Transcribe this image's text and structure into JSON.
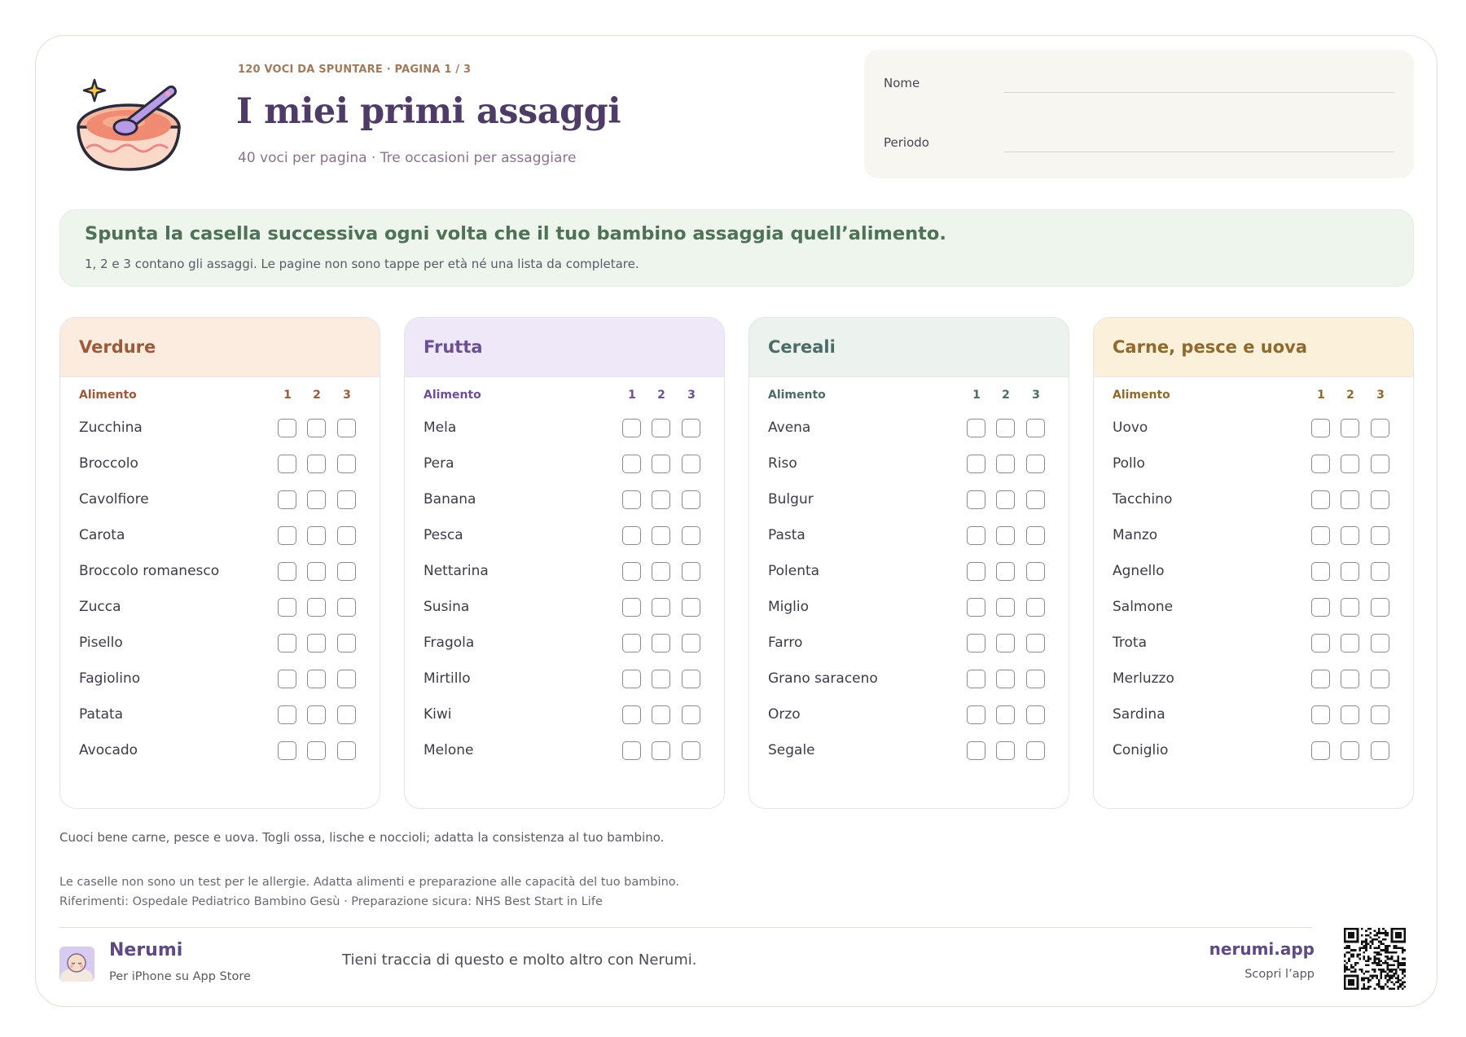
{
  "header": {
    "kicker": "120 VOCI DA SPUNTARE · PAGINA 1 / 3",
    "title": "I miei primi assaggi",
    "subtitle": "40 voci per pagina · Tre occasioni per assaggiare"
  },
  "form": {
    "name_label": "Nome",
    "period_label": "Periodo"
  },
  "banner": {
    "title": "Spunta la casella successiva ogni volta che il tuo bambino assaggia quell’alimento.",
    "subtitle": "1, 2 e 3 contano gli assaggi. Le pagine non sono tappe per età né una lista da completare."
  },
  "table_headers": {
    "food": "Alimento",
    "n1": "1",
    "n2": "2",
    "n3": "3"
  },
  "categories": [
    {
      "title": "Verdure",
      "color": "#9b5a39",
      "items": [
        "Zucchina",
        "Broccolo",
        "Cavolfiore",
        "Carota",
        "Broccolo romanesco",
        "Zucca",
        "Pisello",
        "Fagiolino",
        "Patata",
        "Avocado"
      ]
    },
    {
      "title": "Frutta",
      "color": "#6c4f94",
      "items": [
        "Mela",
        "Pera",
        "Banana",
        "Pesca",
        "Nettarina",
        "Susina",
        "Fragola",
        "Mirtillo",
        "Kiwi",
        "Melone"
      ]
    },
    {
      "title": "Cereali",
      "color": "#4d6b67",
      "items": [
        "Avena",
        "Riso",
        "Bulgur",
        "Pasta",
        "Polenta",
        "Miglio",
        "Farro",
        "Grano saraceno",
        "Orzo",
        "Segale"
      ]
    },
    {
      "title": "Carne, pesce e uova",
      "color": "#8f6a2c",
      "items": [
        "Uovo",
        "Pollo",
        "Tacchino",
        "Manzo",
        "Agnello",
        "Salmone",
        "Trota",
        "Merluzzo",
        "Sardina",
        "Coniglio"
      ]
    }
  ],
  "notes": {
    "safety": "Cuoci bene carne, pesce e uova. Togli ossa, lische e noccioli; adatta la consistenza al tuo bambino.",
    "disclaimer": "Le caselle non sono un test per le allergie. Adatta alimenti e preparazione alle capacità del tuo bambino.",
    "references": "Riferimenti: Ospedale Pediatrico Bambino Gesù · Preparazione sicura: NHS Best Start in Life"
  },
  "footer": {
    "brand": "Nerumi",
    "brand_sub": "Per iPhone su App Store",
    "tagline": "Tieni traccia di questo e molto altro con Nerumi.",
    "url": "nerumi.app",
    "url_sub": "Scopri l’app"
  },
  "icons": {
    "logo": "baby-food-bowl-icon",
    "footer": "sleeping-baby-icon",
    "qr": "qr-code"
  }
}
